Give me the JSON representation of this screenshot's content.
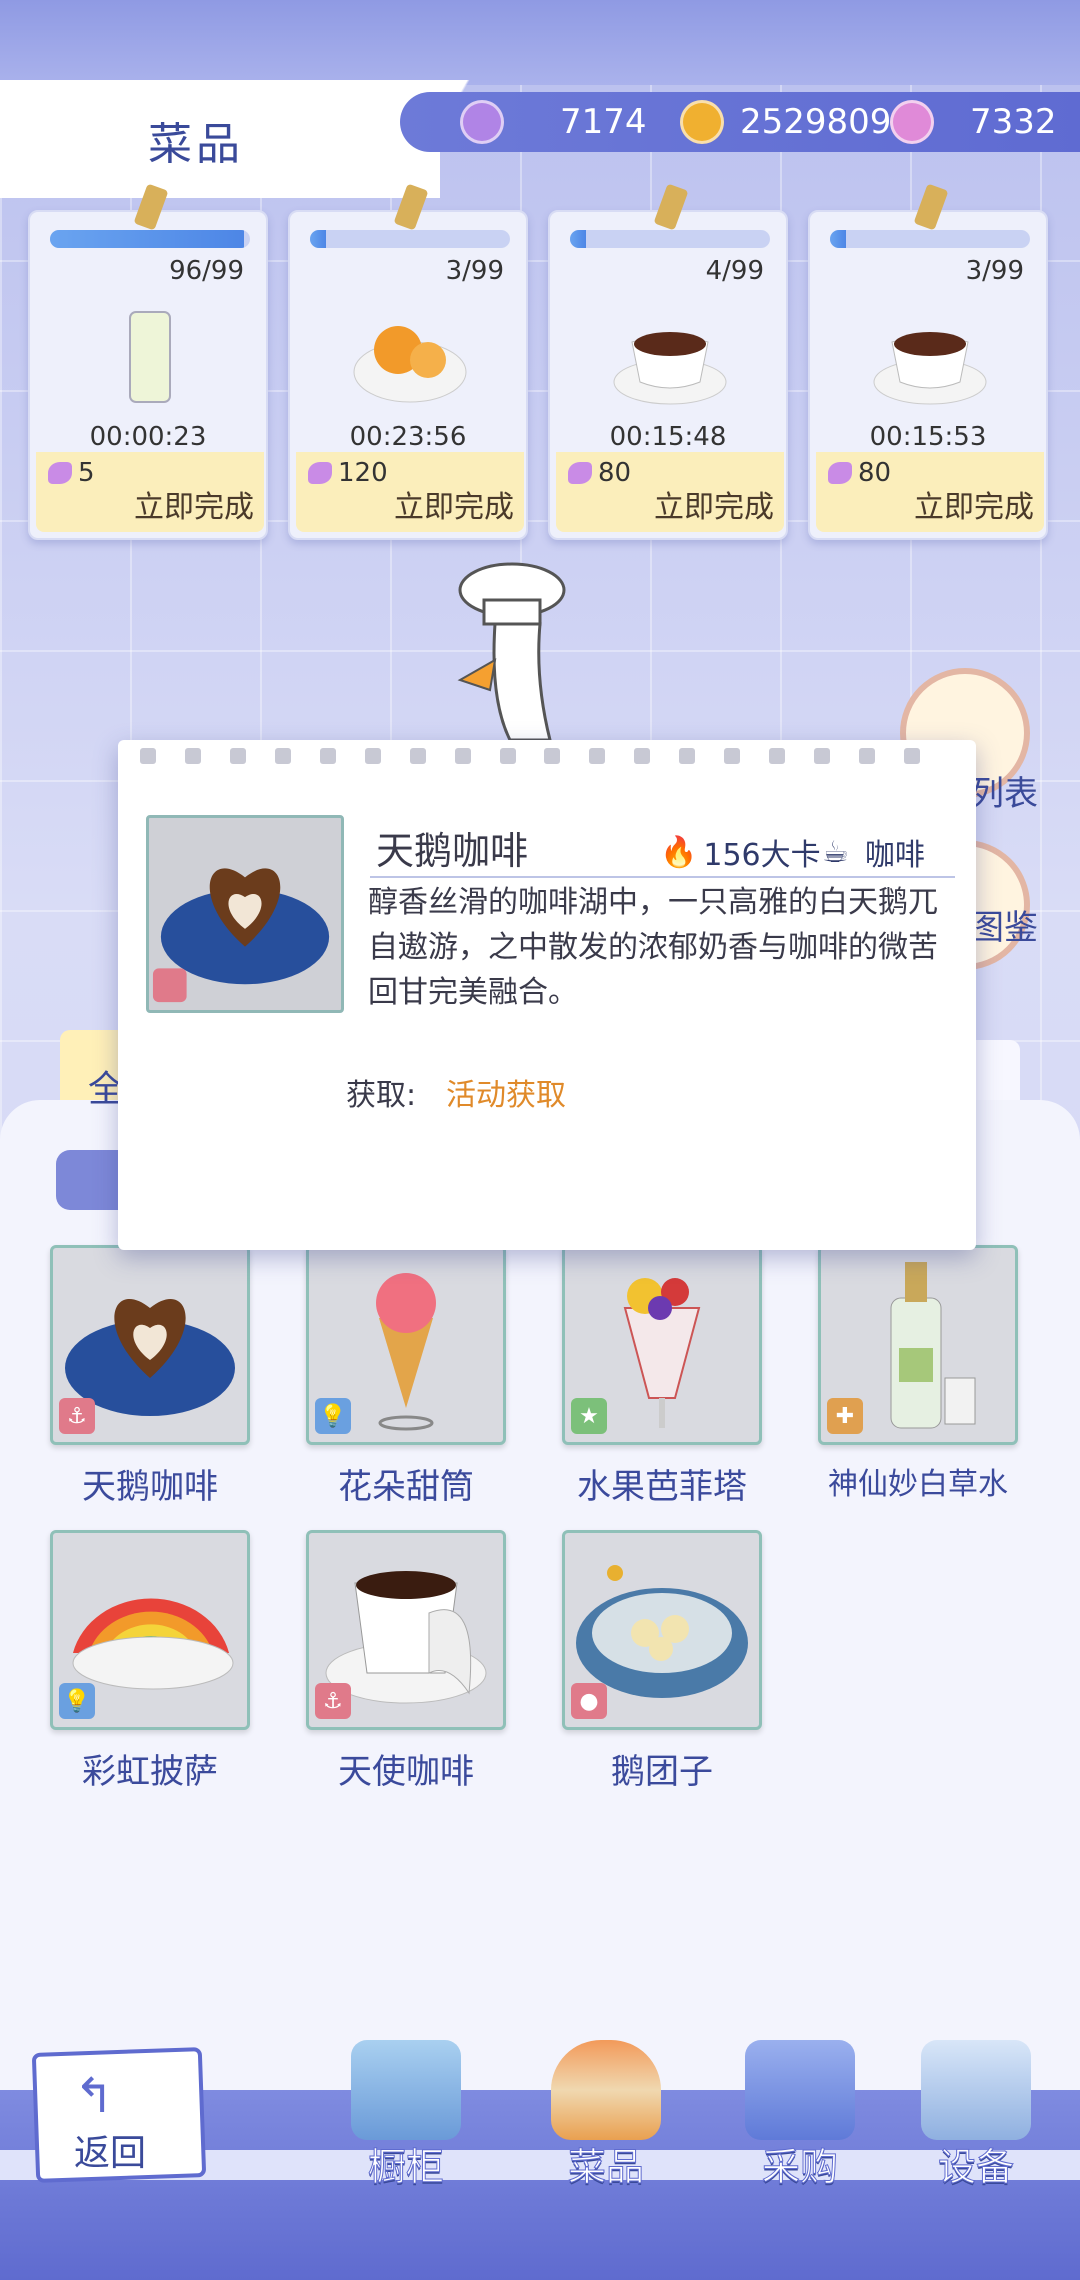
{
  "header": {
    "title": "菜品"
  },
  "resources": [
    {
      "icon": "purple-gem-icon",
      "value": "7174",
      "color": "#b084e6"
    },
    {
      "icon": "gold-coin-icon",
      "value": "2529809",
      "color": "#f0b030"
    },
    {
      "icon": "swan-feather-icon",
      "value": "7332",
      "color": "#e08ad8"
    }
  ],
  "queue": [
    {
      "count": "96/99",
      "progress": 0.97,
      "time": "00:00:23",
      "cost": "5",
      "action": "立即完成",
      "food_icon": "milk-drink-icon"
    },
    {
      "count": "3/99",
      "progress": 0.03,
      "time": "00:23:56",
      "cost": "120",
      "action": "立即完成",
      "food_icon": "orange-dessert-icon"
    },
    {
      "count": "4/99",
      "progress": 0.04,
      "time": "00:15:48",
      "cost": "80",
      "action": "立即完成",
      "food_icon": "coffee-cup-icon"
    },
    {
      "count": "3/99",
      "progress": 0.03,
      "time": "00:15:53",
      "cost": "80",
      "action": "立即完成",
      "food_icon": "coffee-cup-icon"
    }
  ],
  "side": {
    "list_label": "列表",
    "guide_label": "图鉴"
  },
  "panel": {
    "tab_all": "全"
  },
  "popup": {
    "name": "天鹅咖啡",
    "kcal": "156大卡",
    "type": "咖啡",
    "description": "醇香丝滑的咖啡湖中，一只高雅的白天鹅兀自遨游，之中散发的浓郁奶香与咖啡的微苦回甘完美融合。",
    "source_label": "获取:",
    "source": "活动获取"
  },
  "dishes": [
    {
      "name": "天鹅咖啡",
      "badge": "anchor-badge-icon",
      "badge_color": "#e07a8a"
    },
    {
      "name": "花朵甜筒",
      "badge": "bulb-badge-icon",
      "badge_color": "#6aa0e0"
    },
    {
      "name": "水果芭菲塔",
      "badge": "star-badge-icon",
      "badge_color": "#7cc07a"
    },
    {
      "name": "神仙妙白草水",
      "badge": "puzzle-badge-icon",
      "badge_color": "#e0a050"
    },
    {
      "name": "彩虹披萨",
      "badge": "bulb-badge-icon",
      "badge_color": "#6aa0e0"
    },
    {
      "name": "天使咖啡",
      "badge": "anchor-badge-icon",
      "badge_color": "#e07a8a"
    },
    {
      "name": "鹅团子",
      "badge": "lantern-badge-icon",
      "badge_color": "#e07a8a"
    }
  ],
  "nav": {
    "back": "返回",
    "items": [
      {
        "label": "橱柜",
        "icon": "cabinet-icon"
      },
      {
        "label": "菜品",
        "icon": "burger-icon"
      },
      {
        "label": "采购",
        "icon": "shopping-bag-icon"
      },
      {
        "label": "设备",
        "icon": "coffee-machine-icon"
      }
    ]
  }
}
